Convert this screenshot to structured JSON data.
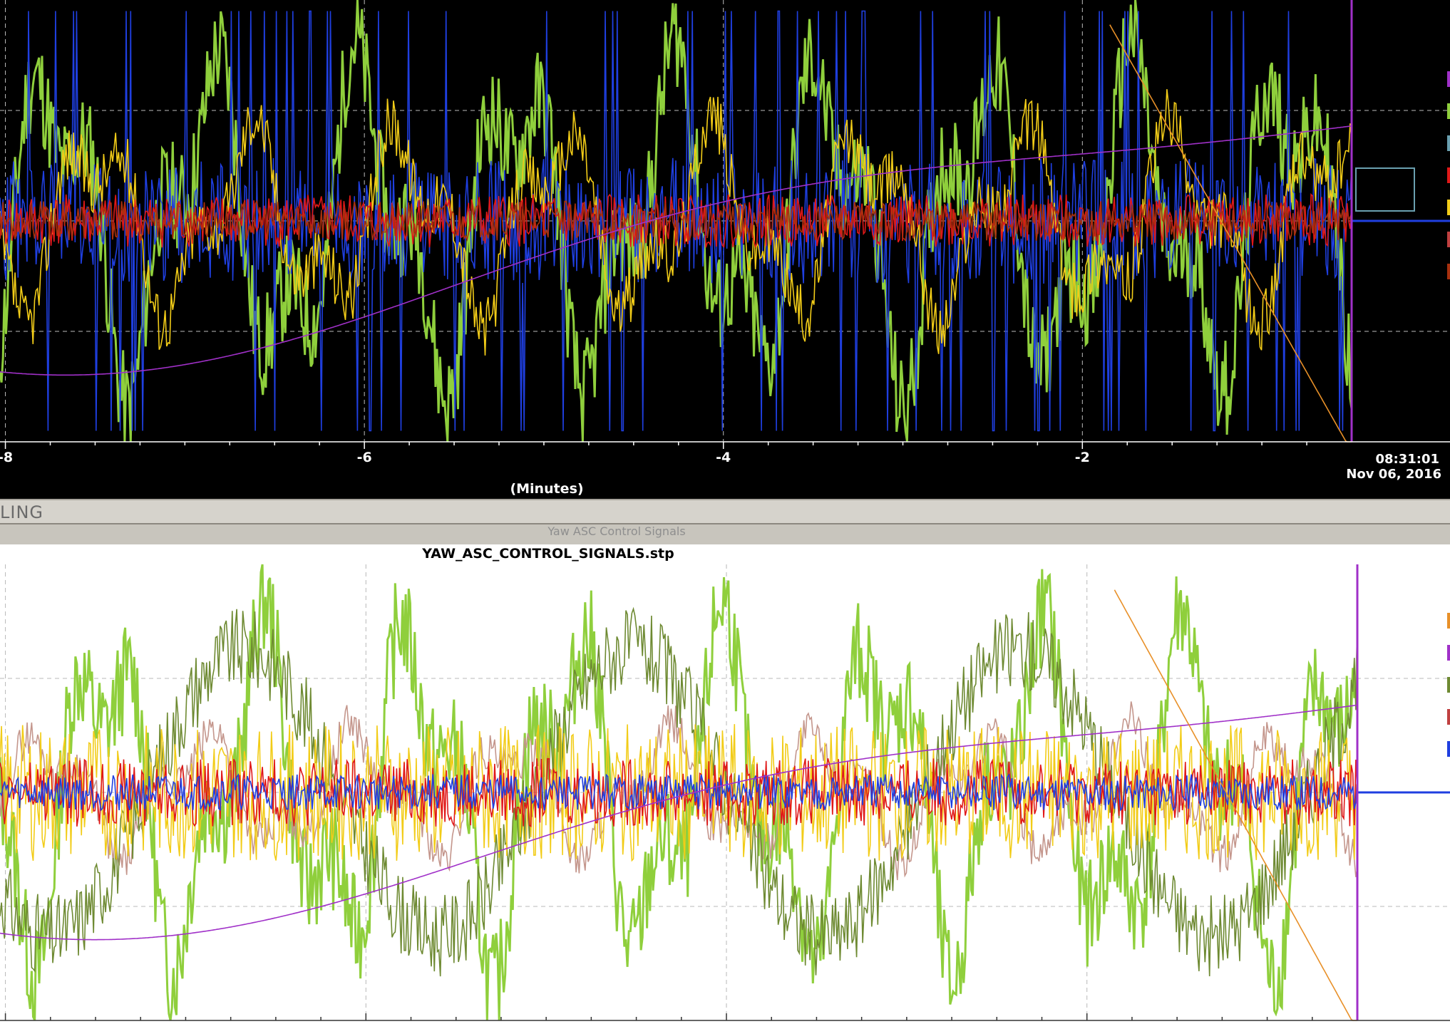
{
  "top_panel": {
    "x_axis_label": "(Minutes)",
    "timestamp_time": "08:31:01",
    "timestamp_date": "Nov 06, 2016"
  },
  "status_text": "LING",
  "window_title": "Yaw ASC Control Signals",
  "bottom_panel": {
    "title": "YAW_ASC_CONTROL_SIGNALS.stp"
  },
  "chart_data": [
    {
      "type": "line",
      "xlim": [
        -8.03,
        -0.5
      ],
      "xticks": [
        -8,
        -6,
        -4,
        -2
      ],
      "xtick_labels": [
        "-8",
        "-6",
        "-4",
        "-2"
      ],
      "xlabel": "(Minutes)",
      "ylim": [
        -1,
        1
      ],
      "grid": true,
      "background": "#000000",
      "data_end_x": -0.5,
      "series": [
        {
          "color": "#8fcf3c",
          "amplitude": 0.95,
          "wave": "fast",
          "seed": 11
        },
        {
          "color": "#1f3fe0",
          "amplitude": 0.95,
          "wave": "spike",
          "seed": 23
        },
        {
          "color": "#f2cc18",
          "amplitude": 0.55,
          "wave": "fast",
          "seed": 37
        },
        {
          "color": "#e01818",
          "amplitude": 0.12,
          "wave": "noise",
          "seed": 41
        },
        {
          "color": "#a8300e",
          "amplitude": 0.09,
          "wave": "noise",
          "seed": 53
        },
        {
          "color": "#a030c8",
          "amplitude": 0.7,
          "wave": "slow",
          "seed": 67
        },
        {
          "color": "#e89028",
          "amplitude": 0.9,
          "wave": "ramp",
          "seed": 71
        }
      ],
      "legend_colors": [
        "#a030c8",
        "#8fcf3c",
        "#6aa0b0",
        "#e01818",
        "#f2cc18",
        "#c04040",
        "#a8300e"
      ]
    },
    {
      "type": "line",
      "title": "YAW_ASC_CONTROL_SIGNALS.stp",
      "xlim": [
        -8.03,
        -0.5
      ],
      "xticks": [
        -8,
        -6,
        -4,
        -2
      ],
      "ylim": [
        -1,
        1
      ],
      "grid": true,
      "background": "#ffffff",
      "data_end_x": -0.5,
      "series": [
        {
          "color": "#8fcf3c",
          "amplitude": 0.95,
          "wave": "fast",
          "seed": 13
        },
        {
          "color": "#c4968c",
          "amplitude": 0.35,
          "wave": "fast",
          "seed": 29
        },
        {
          "color": "#6e8a32",
          "amplitude": 0.9,
          "wave": "medium",
          "seed": 31
        },
        {
          "color": "#f2cc18",
          "amplitude": 0.3,
          "wave": "noise",
          "seed": 43
        },
        {
          "color": "#e01818",
          "amplitude": 0.15,
          "wave": "noise",
          "seed": 47
        },
        {
          "color": "#1f3fe0",
          "amplitude": 0.08,
          "wave": "noise",
          "seed": 59
        },
        {
          "color": "#a030c8",
          "amplitude": 0.65,
          "wave": "slow",
          "seed": 61
        },
        {
          "color": "#e89028",
          "amplitude": 0.9,
          "wave": "ramp",
          "seed": 79
        }
      ],
      "legend_colors": [
        "#e89028",
        "#a030c8",
        "#6e8a32",
        "#c04040",
        "#1f3fe0"
      ]
    }
  ]
}
